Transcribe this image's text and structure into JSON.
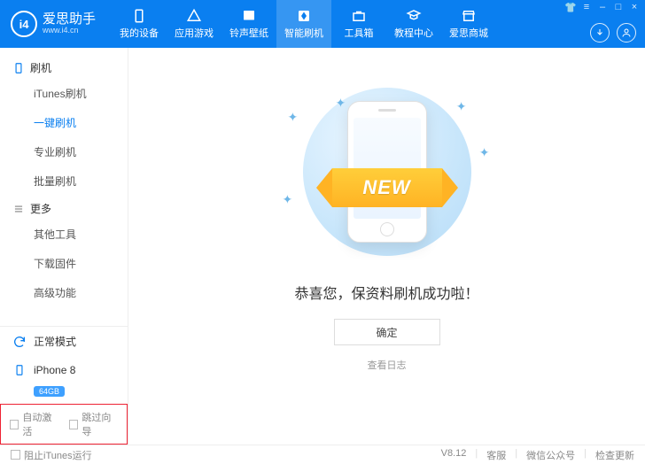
{
  "app": {
    "name": "爱思助手",
    "url": "www.i4.cn"
  },
  "nav": {
    "items": [
      {
        "label": "我的设备",
        "icon": "device"
      },
      {
        "label": "应用游戏",
        "icon": "apps"
      },
      {
        "label": "铃声壁纸",
        "icon": "ringtone"
      },
      {
        "label": "智能刷机",
        "icon": "flash",
        "active": true
      },
      {
        "label": "工具箱",
        "icon": "toolbox"
      },
      {
        "label": "教程中心",
        "icon": "tutorial"
      },
      {
        "label": "爱思商城",
        "icon": "store"
      }
    ]
  },
  "sidebar": {
    "sections": [
      {
        "title": "刷机",
        "items": [
          "iTunes刷机",
          "一键刷机",
          "专业刷机",
          "批量刷机"
        ],
        "activeIndex": 1
      },
      {
        "title": "更多",
        "items": [
          "其他工具",
          "下载固件",
          "高级功能"
        ]
      }
    ],
    "mode": "正常模式",
    "device": {
      "name": "iPhone 8",
      "capacity": "64GB"
    },
    "checks": {
      "autoActivate": "自动激活",
      "skipGuide": "跳过向导"
    }
  },
  "main": {
    "ribbon": "NEW",
    "message": "恭喜您，保资料刷机成功啦！",
    "okBtn": "确定",
    "logLink": "查看日志"
  },
  "footer": {
    "blockItunes": "阻止iTunes运行",
    "version": "V8.12",
    "links": [
      "客服",
      "微信公众号",
      "检查更新"
    ]
  }
}
